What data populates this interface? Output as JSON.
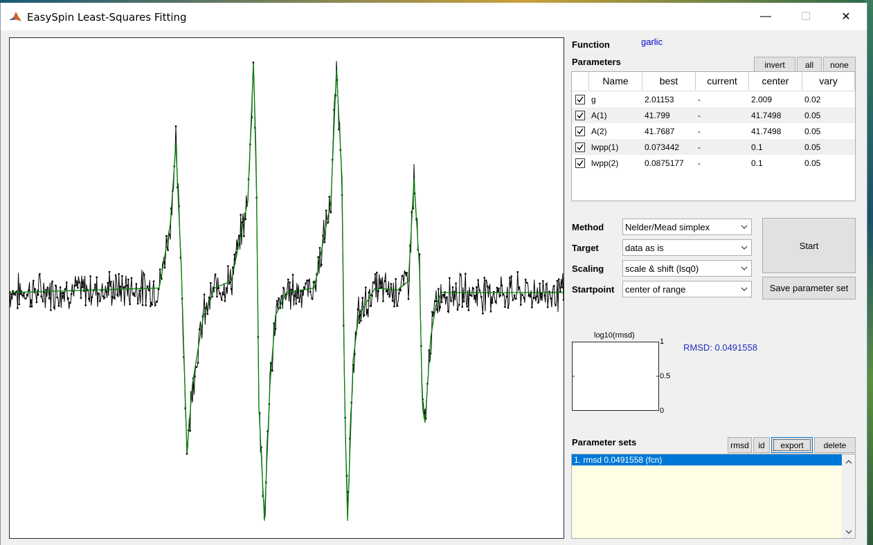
{
  "window": {
    "title": "EasySpin Least-Squares Fitting",
    "minimize": "—",
    "maximize": "☐",
    "close": "✕"
  },
  "function": {
    "label": "Function",
    "value": "garlic"
  },
  "parameters": {
    "label": "Parameters",
    "buttons": {
      "invert": "invert",
      "all": "all",
      "none": "none"
    },
    "columns": [
      "",
      "Name",
      "best",
      "current",
      "center",
      "vary"
    ],
    "rows": [
      {
        "checked": true,
        "name": "g",
        "best": "2.01153",
        "current": "-",
        "center": "2.009",
        "vary": "0.02"
      },
      {
        "checked": true,
        "name": "A(1)",
        "best": "41.799",
        "current": "-",
        "center": "41.7498",
        "vary": "0.05"
      },
      {
        "checked": true,
        "name": "A(2)",
        "best": "41.7687",
        "current": "-",
        "center": "41.7498",
        "vary": "0.05"
      },
      {
        "checked": true,
        "name": "lwpp(1)",
        "best": "0.073442",
        "current": "-",
        "center": "0.1",
        "vary": "0.05"
      },
      {
        "checked": true,
        "name": "lwpp(2)",
        "best": "0.0875177",
        "current": "-",
        "center": "0.1",
        "vary": "0.05"
      }
    ]
  },
  "settings": {
    "method": {
      "label": "Method",
      "value": "Nelder/Mead simplex"
    },
    "target": {
      "label": "Target",
      "value": "data as is"
    },
    "scaling": {
      "label": "Scaling",
      "value": "scale & shift (lsq0)"
    },
    "startpoint": {
      "label": "Startpoint",
      "value": "center of range"
    }
  },
  "actions": {
    "start": "Start",
    "save": "Save parameter set"
  },
  "rmsd_plot": {
    "title": "log10(rmsd)",
    "ticks": [
      "1",
      "0.5",
      "0"
    ],
    "value_text": "RMSD: 0.0491558"
  },
  "parameter_sets": {
    "label": "Parameter sets",
    "buttons": {
      "rmsd": "rmsd",
      "id": "id",
      "export": "export",
      "delete": "delete"
    },
    "items": [
      "1. rmsd 0.0491558 (fcn)"
    ]
  },
  "colors": {
    "data": "#000000",
    "fit": "#008000",
    "selection": "#0078d7",
    "function_value": "#0000cc"
  },
  "chart_data": {
    "type": "line",
    "title": "",
    "xlabel": "",
    "ylabel": "",
    "series": [
      {
        "x": [
          0,
          0.27,
          0.29,
          0.3,
          0.31,
          0.32,
          0.33,
          0.35,
          0.36,
          0.37,
          0.4,
          0.43,
          0.44,
          0.445,
          0.45,
          0.46,
          0.47,
          0.48,
          0.5,
          0.55,
          0.58,
          0.59,
          0.6,
          0.605,
          0.61,
          0.62,
          0.63,
          0.66,
          0.7,
          0.72,
          0.73,
          0.74,
          0.745,
          0.75,
          0.76,
          0.77,
          0.78,
          0.8,
          1
        ],
        "y": [
          0,
          0.02,
          0.3,
          0.65,
          0.1,
          -0.7,
          -0.4,
          -0.1,
          -0.05,
          0.02,
          0.05,
          0.4,
          1.0,
          0.6,
          -0.5,
          -1.0,
          -0.4,
          -0.1,
          0.0,
          0.02,
          0.4,
          0.98,
          0.5,
          -0.5,
          -1.0,
          -0.3,
          -0.1,
          0.02,
          0.01,
          0.05,
          0.5,
          0.1,
          -0.5,
          -0.57,
          -0.2,
          -0.05,
          0.0,
          0.0,
          0.0
        ]
      }
    ]
  }
}
